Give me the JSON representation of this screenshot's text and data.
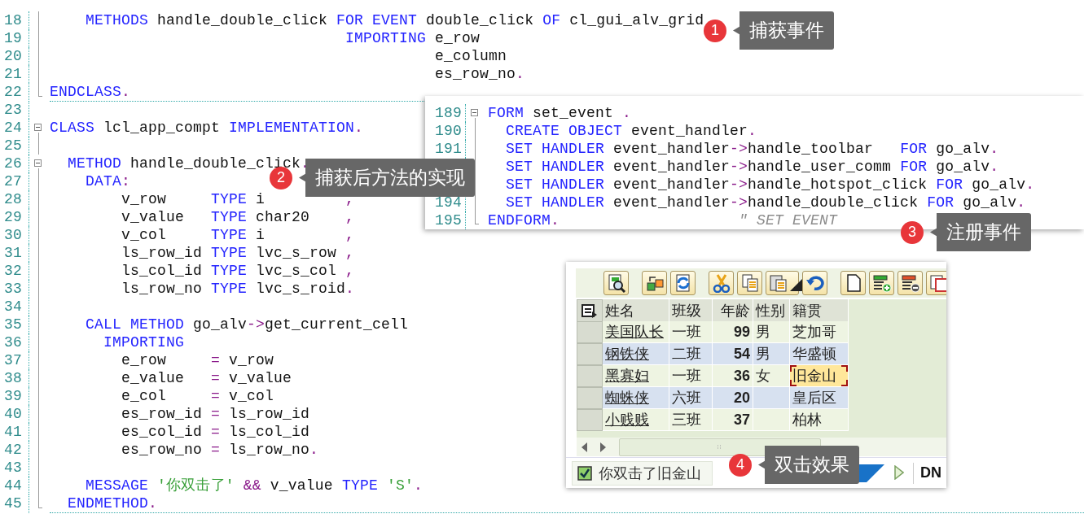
{
  "main_editor": {
    "lines": [
      {
        "number": "18",
        "block_line": true,
        "tokens": [
          {
            "kind": "kw",
            "text": "    METHODS"
          },
          {
            "kind": "id",
            "text": " handle_double_click "
          },
          {
            "kind": "kw",
            "text": "FOR EVENT"
          },
          {
            "kind": "id",
            "text": " double_click "
          },
          {
            "kind": "kw",
            "text": "OF"
          },
          {
            "kind": "id",
            "text": " cl_gui_alv_grid"
          }
        ]
      },
      {
        "number": "19",
        "block_line": true,
        "tokens": [
          {
            "kind": "kw",
            "text": "                                 IMPORTING"
          },
          {
            "kind": "id",
            "text": " e_row"
          }
        ]
      },
      {
        "number": "20",
        "block_line": true,
        "tokens": [
          {
            "kind": "id",
            "text": "                                           e_column"
          }
        ]
      },
      {
        "number": "21",
        "block_line": true,
        "tokens": [
          {
            "kind": "id",
            "text": "                                           es_row_no"
          },
          {
            "kind": "p",
            "text": "."
          }
        ]
      },
      {
        "number": "22",
        "block_end": true,
        "divider": true,
        "tokens": [
          {
            "kind": "kw",
            "text": "ENDCLASS"
          },
          {
            "kind": "p",
            "text": "."
          }
        ]
      },
      {
        "number": "23"
      },
      {
        "number": "24",
        "collapsible": true,
        "tokens": [
          {
            "kind": "kw",
            "text": "CLASS"
          },
          {
            "kind": "id",
            "text": " lcl_app_compt "
          },
          {
            "kind": "kw",
            "text": "IMPLEMENTATION"
          },
          {
            "kind": "p",
            "text": "."
          }
        ]
      },
      {
        "number": "25",
        "block_line": true
      },
      {
        "number": "26",
        "collapsible": true,
        "tokens": [
          {
            "kind": "kw",
            "text": "  METHOD"
          },
          {
            "kind": "id",
            "text": " handle_double_click"
          },
          {
            "kind": "p",
            "text": "."
          }
        ]
      },
      {
        "number": "27",
        "block_line": true,
        "tokens": [
          {
            "kind": "kw",
            "text": "    DATA"
          },
          {
            "kind": "p",
            "text": ":"
          }
        ]
      },
      {
        "number": "28",
        "block_line": true,
        "tokens": [
          {
            "kind": "id",
            "text": "        v_row     "
          },
          {
            "kind": "kw",
            "text": "TYPE"
          },
          {
            "kind": "id",
            "text": " i         "
          },
          {
            "kind": "p",
            "text": ","
          }
        ]
      },
      {
        "number": "29",
        "block_line": true,
        "tokens": [
          {
            "kind": "id",
            "text": "        v_value   "
          },
          {
            "kind": "kw",
            "text": "TYPE"
          },
          {
            "kind": "id",
            "text": " char20    "
          },
          {
            "kind": "p",
            "text": ","
          }
        ]
      },
      {
        "number": "30",
        "block_line": true,
        "tokens": [
          {
            "kind": "id",
            "text": "        v_col     "
          },
          {
            "kind": "kw",
            "text": "TYPE"
          },
          {
            "kind": "id",
            "text": " i         "
          },
          {
            "kind": "p",
            "text": ","
          }
        ]
      },
      {
        "number": "31",
        "block_line": true,
        "tokens": [
          {
            "kind": "id",
            "text": "        ls_row_id "
          },
          {
            "kind": "kw",
            "text": "TYPE"
          },
          {
            "kind": "id",
            "text": " lvc_s_row "
          },
          {
            "kind": "p",
            "text": ","
          }
        ]
      },
      {
        "number": "32",
        "block_line": true,
        "tokens": [
          {
            "kind": "id",
            "text": "        ls_col_id "
          },
          {
            "kind": "kw",
            "text": "TYPE"
          },
          {
            "kind": "id",
            "text": " lvc_s_col "
          },
          {
            "kind": "p",
            "text": ","
          }
        ]
      },
      {
        "number": "33",
        "block_line": true,
        "tokens": [
          {
            "kind": "id",
            "text": "        ls_row_no "
          },
          {
            "kind": "kw",
            "text": "TYPE"
          },
          {
            "kind": "id",
            "text": " lvc_s_roid"
          },
          {
            "kind": "p",
            "text": "."
          }
        ]
      },
      {
        "number": "34",
        "block_line": true
      },
      {
        "number": "35",
        "block_line": true,
        "tokens": [
          {
            "kind": "kw",
            "text": "    CALL METHOD"
          },
          {
            "kind": "id",
            "text": " go_alv"
          },
          {
            "kind": "p",
            "text": "->"
          },
          {
            "kind": "id",
            "text": "get_current_cell"
          }
        ]
      },
      {
        "number": "36",
        "block_line": true,
        "tokens": [
          {
            "kind": "kw",
            "text": "      IMPORTING"
          }
        ]
      },
      {
        "number": "37",
        "block_line": true,
        "tokens": [
          {
            "kind": "id",
            "text": "        e_row     "
          },
          {
            "kind": "p",
            "text": "="
          },
          {
            "kind": "id",
            "text": " v_row"
          }
        ]
      },
      {
        "number": "38",
        "block_line": true,
        "tokens": [
          {
            "kind": "id",
            "text": "        e_value   "
          },
          {
            "kind": "p",
            "text": "="
          },
          {
            "kind": "id",
            "text": " v_value"
          }
        ]
      },
      {
        "number": "39",
        "block_line": true,
        "tokens": [
          {
            "kind": "id",
            "text": "        e_col     "
          },
          {
            "kind": "p",
            "text": "="
          },
          {
            "kind": "id",
            "text": " v_col"
          }
        ]
      },
      {
        "number": "40",
        "block_line": true,
        "tokens": [
          {
            "kind": "id",
            "text": "        es_row_id "
          },
          {
            "kind": "p",
            "text": "="
          },
          {
            "kind": "id",
            "text": " ls_row_id"
          }
        ]
      },
      {
        "number": "41",
        "block_line": true,
        "tokens": [
          {
            "kind": "id",
            "text": "        es_col_id "
          },
          {
            "kind": "p",
            "text": "="
          },
          {
            "kind": "id",
            "text": " ls_col_id"
          }
        ]
      },
      {
        "number": "42",
        "block_line": true,
        "tokens": [
          {
            "kind": "id",
            "text": "        es_row_no "
          },
          {
            "kind": "p",
            "text": "="
          },
          {
            "kind": "id",
            "text": " ls_row_no"
          },
          {
            "kind": "p",
            "text": "."
          }
        ]
      },
      {
        "number": "43",
        "block_line": true
      },
      {
        "number": "44",
        "block_line": true,
        "tokens": [
          {
            "kind": "kw",
            "text": "    MESSAGE "
          },
          {
            "kind": "str",
            "text": "'你双击了'"
          },
          {
            "kind": "p",
            "text": " && "
          },
          {
            "kind": "id",
            "text": "v_value "
          },
          {
            "kind": "kw",
            "text": "TYPE "
          },
          {
            "kind": "str",
            "text": "'S'"
          },
          {
            "kind": "p",
            "text": "."
          }
        ]
      },
      {
        "number": "45",
        "block_end": true,
        "divider": true,
        "tokens": [
          {
            "kind": "kw",
            "text": "  ENDMETHOD"
          },
          {
            "kind": "p",
            "text": "."
          }
        ]
      }
    ]
  },
  "inset_editor": {
    "lines": [
      {
        "number": "189",
        "collapsible": true,
        "tokens": [
          {
            "kind": "kw",
            "text": "FORM"
          },
          {
            "kind": "id",
            "text": " set_event "
          },
          {
            "kind": "p",
            "text": "."
          }
        ]
      },
      {
        "number": "190",
        "block_line": true,
        "tokens": [
          {
            "kind": "kw",
            "text": "  CREATE OBJECT"
          },
          {
            "kind": "id",
            "text": " event_handler"
          },
          {
            "kind": "p",
            "text": "."
          }
        ]
      },
      {
        "number": "191",
        "block_line": true,
        "tokens": [
          {
            "kind": "kw",
            "text": "  SET HANDLER"
          },
          {
            "kind": "id",
            "text": " event_handler"
          },
          {
            "kind": "p",
            "text": "->"
          },
          {
            "kind": "id",
            "text": "handle_toolbar   "
          },
          {
            "kind": "kw",
            "text": "FOR"
          },
          {
            "kind": "id",
            "text": " go_alv"
          },
          {
            "kind": "p",
            "text": "."
          }
        ]
      },
      {
        "block_line": true,
        "tokens": [
          {
            "kind": "kw",
            "text": "  SET HANDLER"
          },
          {
            "kind": "id",
            "text": " event_handler"
          },
          {
            "kind": "p",
            "text": "->"
          },
          {
            "kind": "id",
            "text": "handle_user_comm "
          },
          {
            "kind": "kw",
            "text": "FOR"
          },
          {
            "kind": "id",
            "text": " go_alv"
          },
          {
            "kind": "p",
            "text": "."
          }
        ]
      },
      {
        "block_line": true,
        "tokens": [
          {
            "kind": "kw",
            "text": "  SET HANDLER"
          },
          {
            "kind": "id",
            "text": " event_handler"
          },
          {
            "kind": "p",
            "text": "->"
          },
          {
            "kind": "id",
            "text": "handle_hotspot_click "
          },
          {
            "kind": "kw",
            "text": "FOR"
          },
          {
            "kind": "id",
            "text": " go_alv"
          },
          {
            "kind": "p",
            "text": "."
          }
        ]
      },
      {
        "number": "194",
        "block_line": true,
        "tokens": [
          {
            "kind": "kw",
            "text": "  SET HANDLER"
          },
          {
            "kind": "id",
            "text": " event_handler"
          },
          {
            "kind": "p",
            "text": "->"
          },
          {
            "kind": "id",
            "text": "handle_double_click "
          },
          {
            "kind": "kw",
            "text": "FOR"
          },
          {
            "kind": "id",
            "text": " go_alv"
          },
          {
            "kind": "p",
            "text": "."
          }
        ]
      },
      {
        "number": "195",
        "block_end": true,
        "tokens": [
          {
            "kind": "kw",
            "text": "ENDFORM"
          },
          {
            "kind": "p",
            "text": "."
          },
          {
            "kind": "cm",
            "text": "                    \" SET EVENT"
          }
        ]
      }
    ]
  },
  "alv": {
    "toolbar_groups": [
      {
        "buttons": [
          {
            "kind": "details"
          }
        ]
      },
      {
        "buttons": [
          {
            "kind": "layout"
          },
          {
            "kind": "refresh"
          }
        ]
      },
      {
        "buttons": [
          {
            "kind": "cut"
          },
          {
            "kind": "copy"
          },
          {
            "kind": "paste"
          },
          {
            "kind": "undo"
          }
        ]
      },
      {
        "buttons": [
          {
            "kind": "new"
          },
          {
            "kind": "append"
          },
          {
            "kind": "delete"
          },
          {
            "kind": "window"
          }
        ]
      }
    ],
    "columns": [
      {
        "label": "姓名",
        "kind": "link"
      },
      {
        "label": "班级",
        "kind": "text"
      },
      {
        "label": "年龄",
        "kind": "number"
      },
      {
        "label": "性别",
        "kind": "text"
      },
      {
        "label": "籍贯",
        "kind": "text"
      }
    ],
    "rows": [
      {
        "cells": [
          {
            "text": "美国队长",
            "selected": false
          },
          {
            "text": "一班",
            "selected": false
          },
          {
            "text": "99",
            "selected": false
          },
          {
            "text": "男",
            "selected": false
          },
          {
            "text": "芝加哥",
            "selected": false
          }
        ]
      },
      {
        "cells": [
          {
            "text": "钢铁侠",
            "selected": false
          },
          {
            "text": "二班",
            "selected": false
          },
          {
            "text": "54",
            "selected": false
          },
          {
            "text": "男",
            "selected": false
          },
          {
            "text": "华盛顿",
            "selected": false
          }
        ]
      },
      {
        "cells": [
          {
            "text": "黑寡妇",
            "selected": false
          },
          {
            "text": "一班",
            "selected": false
          },
          {
            "text": "36",
            "selected": false
          },
          {
            "text": "女",
            "selected": false
          },
          {
            "text": "旧金山",
            "selected": true
          }
        ]
      },
      {
        "cells": [
          {
            "text": "蜘蛛侠",
            "selected": false
          },
          {
            "text": "六班",
            "selected": false
          },
          {
            "text": "20",
            "selected": false
          },
          {
            "selected": false
          },
          {
            "text": "皇后区",
            "selected": false
          }
        ]
      },
      {
        "cells": [
          {
            "text": "小贱贱",
            "selected": false
          },
          {
            "text": "三班",
            "selected": false
          },
          {
            "text": "37",
            "selected": false
          },
          {
            "selected": false
          },
          {
            "text": "柏林",
            "selected": false
          }
        ]
      }
    ],
    "status": {
      "message": "你双击了旧金山",
      "system": "DN"
    }
  },
  "callouts": [
    {
      "number": "1",
      "text": "捕获事件"
    },
    {
      "number": "2",
      "text": "捕获后方法的实现"
    },
    {
      "number": "3",
      "text": "注册事件"
    },
    {
      "number": "4",
      "text": "双击效果"
    }
  ]
}
